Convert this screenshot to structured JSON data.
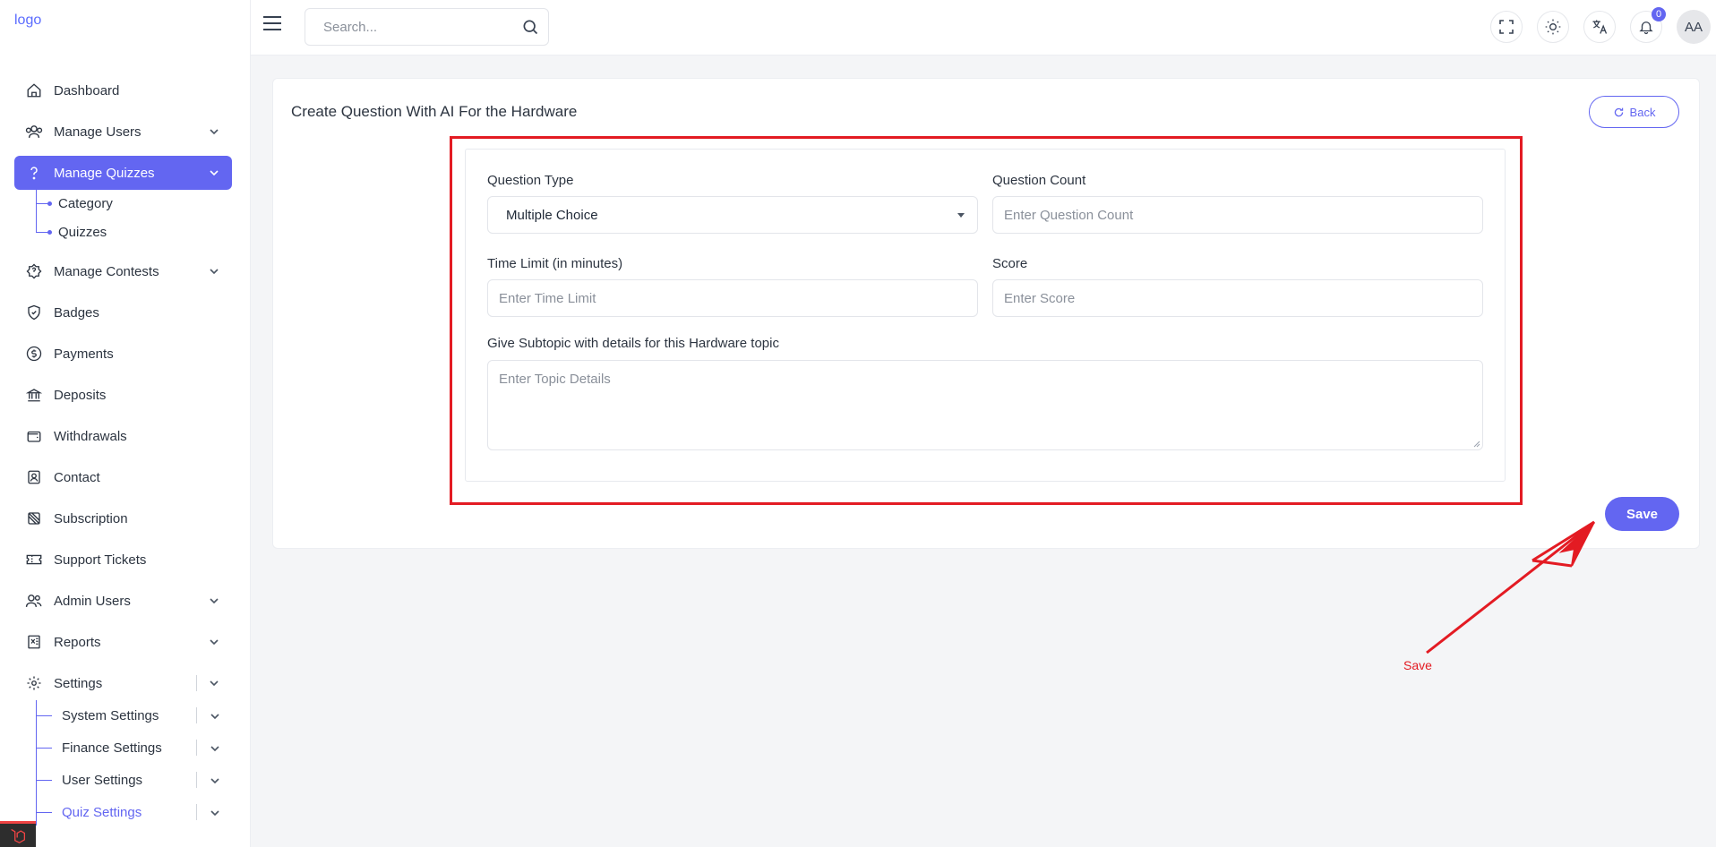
{
  "logo": {
    "alt": "logo"
  },
  "search": {
    "placeholder": "Search..."
  },
  "topbar": {
    "notification_count": "0",
    "avatar_initials": "AA"
  },
  "sidebar": {
    "dashboard": "Dashboard",
    "manage_users": "Manage Users",
    "manage_quizzes": "Manage Quizzes",
    "category": "Category",
    "quizzes": "Quizzes",
    "manage_contests": "Manage Contests",
    "badges": "Badges",
    "payments": "Payments",
    "deposits": "Deposits",
    "withdrawals": "Withdrawals",
    "contact": "Contact",
    "subscription": "Subscription",
    "support_tickets": "Support Tickets",
    "admin_users": "Admin Users",
    "reports": "Reports",
    "settings": "Settings",
    "system_settings": "System Settings",
    "finance_settings": "Finance Settings",
    "user_settings": "User Settings",
    "quiz_settings": "Quiz Settings"
  },
  "page": {
    "title": "Create Question With AI For the Hardware",
    "back_label": "Back",
    "save_label": "Save"
  },
  "form": {
    "question_type_label": "Question Type",
    "question_type_value": "Multiple Choice",
    "question_count_label": "Question Count",
    "question_count_placeholder": "Enter Question Count",
    "time_limit_label": "Time Limit (in minutes)",
    "time_limit_placeholder": "Enter Time Limit",
    "score_label": "Score",
    "score_placeholder": "Enter Score",
    "subtopic_label": "Give Subtopic with details for this Hardware topic",
    "subtopic_placeholder": "Enter Topic Details"
  },
  "annotation": {
    "text": "Save"
  },
  "colors": {
    "accent": "#6366f1",
    "annotation": "#e31b23"
  }
}
